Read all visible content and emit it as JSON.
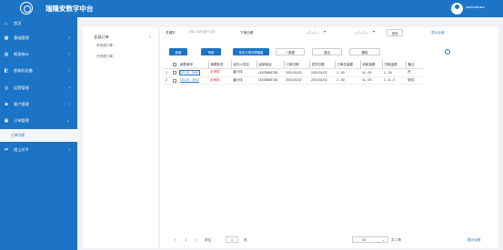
{
  "app": {
    "title": "瑞隆安数字中台",
    "username": "Administrator"
  },
  "sidebar": {
    "home": "首页",
    "items": [
      {
        "label": "基础管理",
        "icon": "grid-icon"
      },
      {
        "label": "报表统计",
        "icon": "chart-icon"
      },
      {
        "label": "智能的设备",
        "icon": "device-icon"
      },
      {
        "label": "运营管理",
        "icon": "ops-icon"
      },
      {
        "label": "客户管理",
        "icon": "user-icon"
      },
      {
        "label": "订单管理",
        "icon": "order-icon"
      }
    ],
    "sub_item": "订单列表",
    "last_item": {
      "label": "线上对平",
      "icon": "link-icon"
    }
  },
  "tree": {
    "title": "全部订单",
    "items": [
      "未完成订单",
      "已完成订单"
    ]
  },
  "filters": {
    "keyword_label": "关键字",
    "keyword_placeholder": "请输入单号/客户名称",
    "date_label": "下单日期",
    "date_from": "__/__/__",
    "date_to": "__/__/__",
    "search_btn": "查询",
    "advanced_link": "显示全部"
  },
  "toolbar": {
    "btn_new": "新增",
    "btn_audit": "审核",
    "btn_export": "导出订单详情模板",
    "btn_add_data": "+ 数据",
    "btn_unaudit": "退出",
    "btn_delete": "删除"
  },
  "table": {
    "headers": [
      "",
      "",
      "销售单号",
      "单据状态",
      "经办人姓名",
      "经销电话",
      "订单日期",
      "发货日期",
      "订单总金额",
      "收款金额",
      "付款金额",
      "备注"
    ],
    "rows": [
      {
        "idx": "1",
        "order_no": "DD-20...0001",
        "status": "未审核",
        "person": "潘小伟",
        "phone": "11678665736",
        "order_date": "2021/01/02",
        "ship_date": "2021/01/02",
        "total": "1...00",
        "received": "11...00",
        "paid": "1...00",
        "note": "开"
      },
      {
        "idx": "2",
        "order_no": "DD-20...0002",
        "status": "未审核",
        "person": "潘小伟",
        "phone": "11678665736",
        "order_date": "2021/01/02",
        "ship_date": "2021/01/02",
        "total": "2...00",
        "received": "11...00",
        "paid": "1...5...0",
        "note": "测试"
      }
    ]
  },
  "pager": {
    "prev": "<",
    "current": "1",
    "next": ">",
    "goto_label": "前往",
    "goto_value": "1",
    "goto_suffix": "页",
    "page_size": "10",
    "total": "共 2 条",
    "help": "图示说明"
  }
}
